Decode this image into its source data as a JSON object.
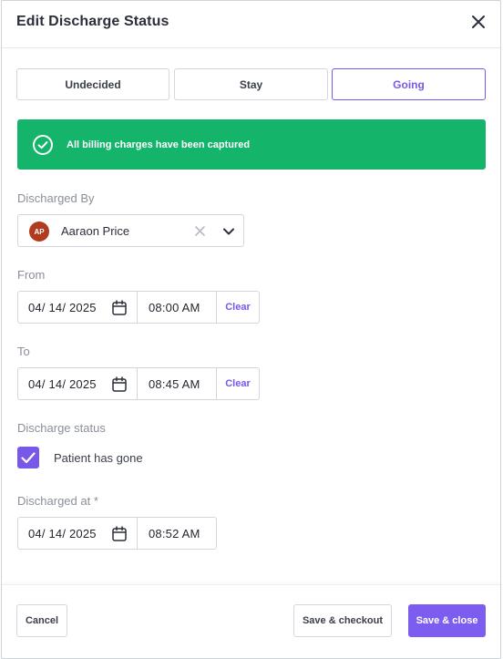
{
  "header": {
    "title": "Edit Discharge Status"
  },
  "tabs": [
    {
      "label": "Undecided",
      "active": false
    },
    {
      "label": "Stay",
      "active": false
    },
    {
      "label": "Going",
      "active": true
    }
  ],
  "banner": {
    "message": "All billing charges have been captured",
    "color": "#14b46a"
  },
  "discharged_by": {
    "label": "Discharged By",
    "avatar_initials": "AP",
    "value": "Aaraon Price"
  },
  "from": {
    "label": "From",
    "date": "04/ 14/ 2025",
    "time": "08:00 AM",
    "clear_label": "Clear"
  },
  "to": {
    "label": "To",
    "date": "04/ 14/ 2025",
    "time": "08:45 AM",
    "clear_label": "Clear"
  },
  "discharge_status": {
    "label": "Discharge status",
    "checkbox_label": "Patient has gone",
    "checked": true
  },
  "discharged_at": {
    "label": "Discharged at *",
    "date": "04/ 14/ 2025",
    "time": "08:52 AM"
  },
  "footer": {
    "cancel_label": "Cancel",
    "save_checkout_label": "Save & checkout",
    "save_close_label": "Save & close"
  },
  "colors": {
    "accent": "#7758e8",
    "success": "#14b46a"
  },
  "icons": {
    "close": "close-icon",
    "banner": "check-circle-icon",
    "clear": "x-icon",
    "dropdown": "chevron-down-icon",
    "date": "calendar-icon",
    "checkbox": "checkmark-icon"
  }
}
